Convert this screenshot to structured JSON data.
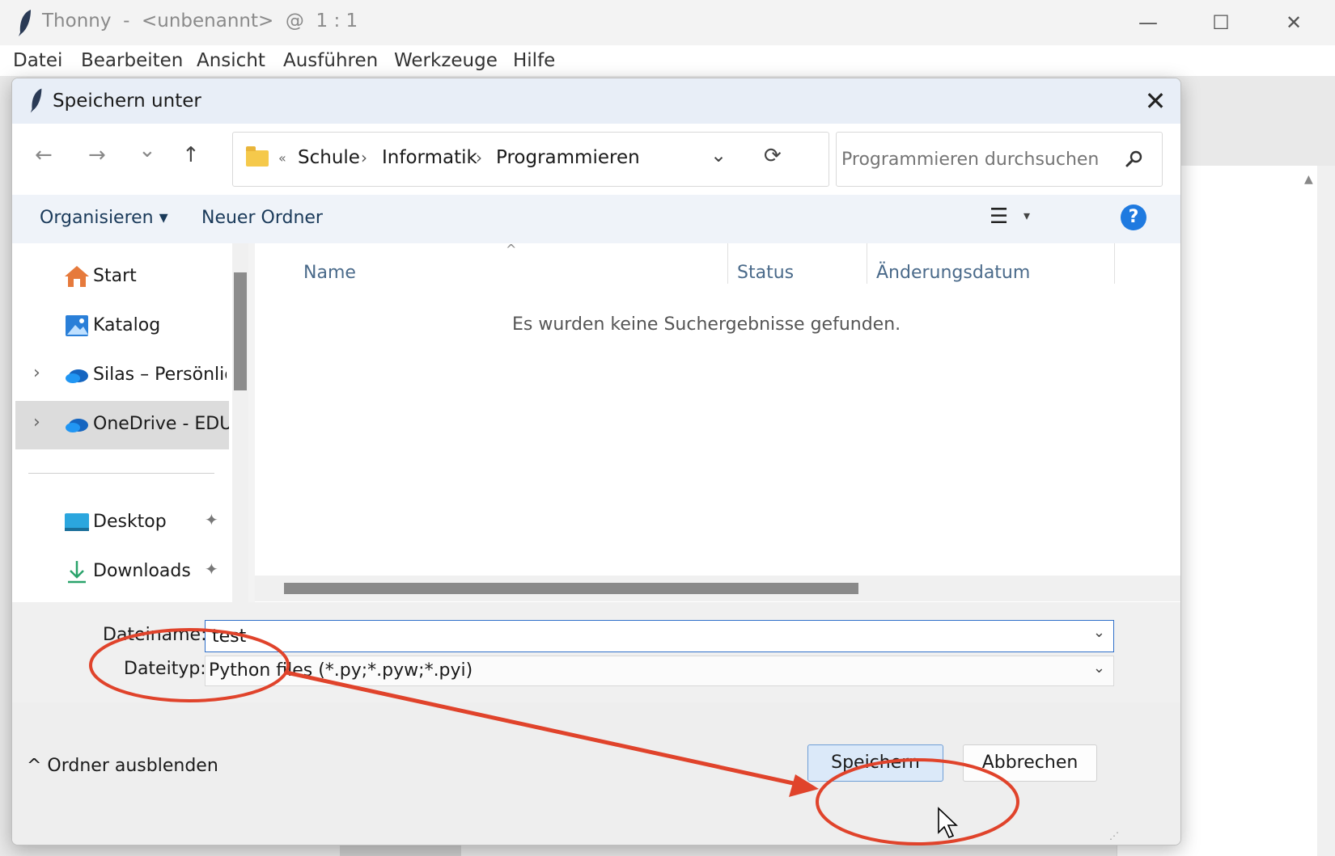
{
  "window": {
    "title": "Thonny  -  <unbenannt>  @  1 : 1",
    "minimize_glyph": "—",
    "maximize_glyph": "☐",
    "close_glyph": "✕"
  },
  "menubar": [
    "Datei",
    "Bearbeiten",
    "Ansicht",
    "Ausführen",
    "Werkzeuge",
    "Hilfe"
  ],
  "dialog": {
    "title": "Speichern unter",
    "close_glyph": "✕",
    "nav": {
      "back": "←",
      "forward": "→",
      "recent": "⌄",
      "up": "↑"
    },
    "breadcrumb": {
      "overflow": "«",
      "items": [
        "Schule",
        "Informatik",
        "Programmieren"
      ],
      "separator": "›",
      "dropdown": "⌄",
      "refresh": "⟳"
    },
    "search": {
      "placeholder": "Programmieren durchsuchen",
      "icon": "search-icon"
    },
    "toolbar": {
      "organize": "Organisieren ▾",
      "new_folder": "Neuer Ordner",
      "view_glyph": "☰",
      "view_dropdown": "▾",
      "help": "?"
    },
    "nav_pane": {
      "items": [
        {
          "label": "Start",
          "icon": "home-icon",
          "expandable": false
        },
        {
          "label": "Katalog",
          "icon": "gallery-icon",
          "expandable": false
        },
        {
          "label": "Silas – Persönlich",
          "icon": "onedrive-icon",
          "expandable": true
        },
        {
          "label": "OneDrive - EDU",
          "icon": "onedrive-icon",
          "expandable": true,
          "selected": true
        }
      ],
      "pinned": [
        {
          "label": "Desktop",
          "icon": "desktop-icon"
        },
        {
          "label": "Downloads",
          "icon": "downloads-icon"
        }
      ],
      "chevron": "›",
      "pin_glyph": "📌"
    },
    "file_list": {
      "columns": [
        "Name",
        "Status",
        "Änderungsdatum"
      ],
      "sort_glyph": "^",
      "empty_message": "Es wurden keine Suchergebnisse gefunden."
    },
    "filename": {
      "label": "Dateiname:",
      "value": "test"
    },
    "filetype": {
      "label": "Dateityp:",
      "value": "Python files (*.py;*.pyw;*.pyi)"
    },
    "dropdown_glyph": "⌄",
    "hide_folders": "^  Ordner ausblenden",
    "save_label": "Speichern",
    "cancel_label": "Abbrechen"
  },
  "colors": {
    "annotation": "#e0432b",
    "accent": "#1f7ae0",
    "selection": "#dcdcdc"
  }
}
